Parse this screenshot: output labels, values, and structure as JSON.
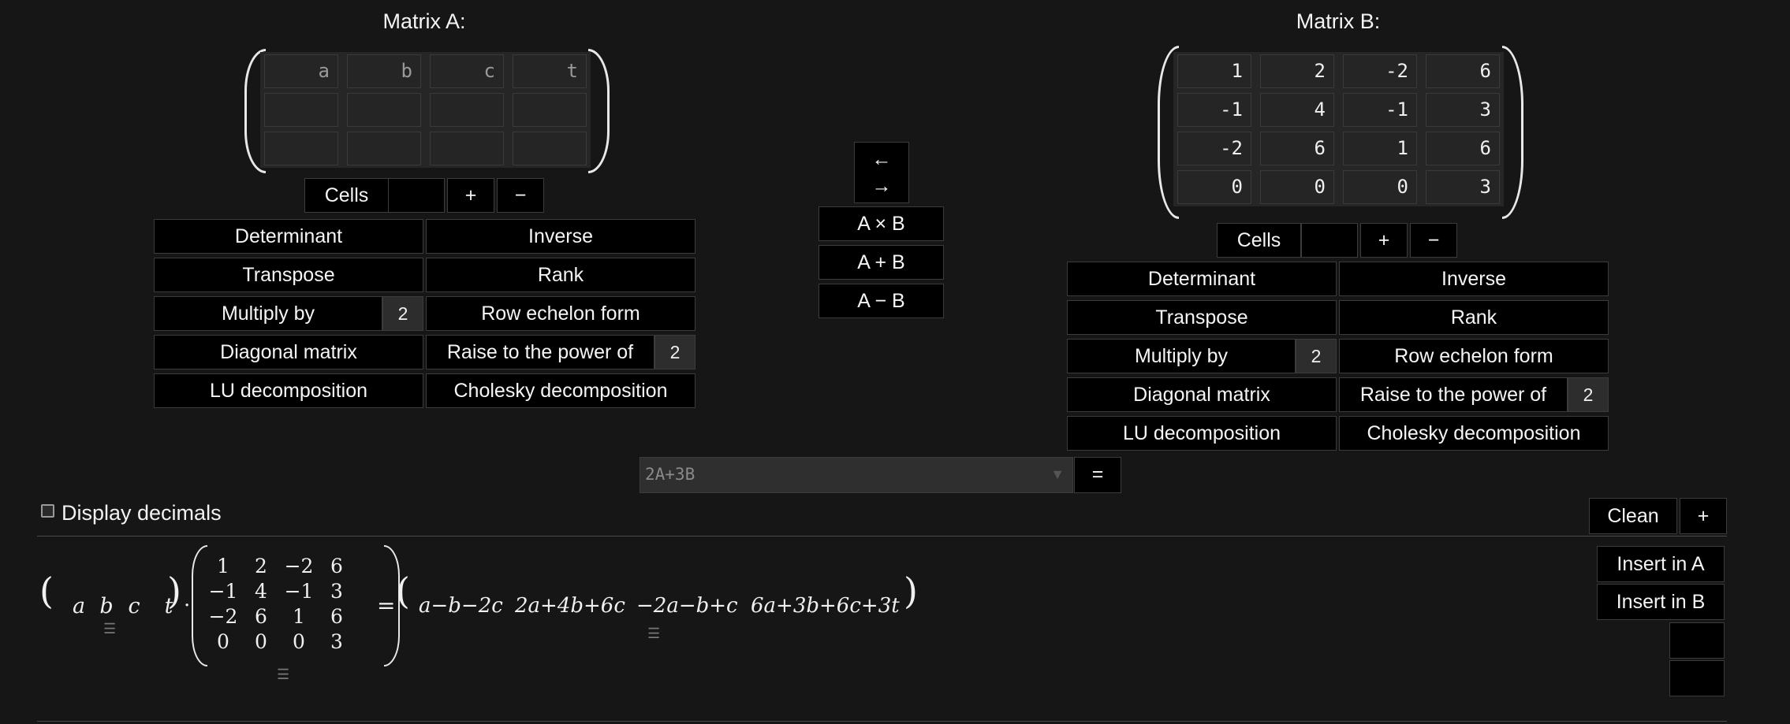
{
  "matrix_a": {
    "title": "Matrix A:",
    "cells": [
      [
        "a",
        "b",
        "c",
        "t"
      ],
      [
        "",
        "",
        "",
        ""
      ],
      [
        "",
        "",
        "",
        ""
      ]
    ],
    "cells_label": "Cells",
    "plus": "+",
    "minus": "−",
    "ops": {
      "determinant": "Determinant",
      "inverse": "Inverse",
      "transpose": "Transpose",
      "rank": "Rank",
      "multiply_by": "Multiply by",
      "multiply_value": "2",
      "row_echelon": "Row echelon form",
      "diagonal": "Diagonal matrix",
      "raise_power": "Raise to the power of",
      "power_value": "2",
      "lu": "LU decomposition",
      "cholesky": "Cholesky decomposition"
    }
  },
  "matrix_b": {
    "title": "Matrix B:",
    "cells": [
      [
        "1",
        "2",
        "-2",
        "6"
      ],
      [
        "-1",
        "4",
        "-1",
        "3"
      ],
      [
        "-2",
        "6",
        "1",
        "6"
      ],
      [
        "0",
        "0",
        "0",
        "3"
      ]
    ],
    "cells_label": "Cells",
    "plus": "+",
    "minus": "−",
    "ops": {
      "determinant": "Determinant",
      "inverse": "Inverse",
      "transpose": "Transpose",
      "rank": "Rank",
      "multiply_by": "Multiply by",
      "multiply_value": "2",
      "row_echelon": "Row echelon form",
      "diagonal": "Diagonal matrix",
      "raise_power": "Raise to the power of",
      "power_value": "2",
      "lu": "LU decomposition",
      "cholesky": "Cholesky decomposition"
    }
  },
  "middle": {
    "swap_left": "←",
    "swap_right": "→",
    "a_times_b": "A × B",
    "a_plus_b": "A + B",
    "a_minus_b": "A − B"
  },
  "expression": {
    "value": "2A+3B",
    "equals": "="
  },
  "toolbar": {
    "display_decimals": "Display decimals",
    "clean": "Clean",
    "add": "+"
  },
  "result": {
    "row_vector": [
      "a",
      "b",
      "c",
      "t"
    ],
    "dot": "·",
    "matrix": [
      [
        "1",
        "2",
        "−2",
        "6"
      ],
      [
        "−1",
        "4",
        "−1",
        "3"
      ],
      [
        "−2",
        "6",
        "1",
        "6"
      ],
      [
        "0",
        "0",
        "0",
        "3"
      ]
    ],
    "equals": "=",
    "output": [
      "a−b−2c",
      "2a+4b+6c",
      "−2a−b+c",
      "6a+3b+6c+3t"
    ],
    "drag_handle": "☰",
    "insert_a": "Insert in A",
    "insert_b": "Insert in B"
  }
}
